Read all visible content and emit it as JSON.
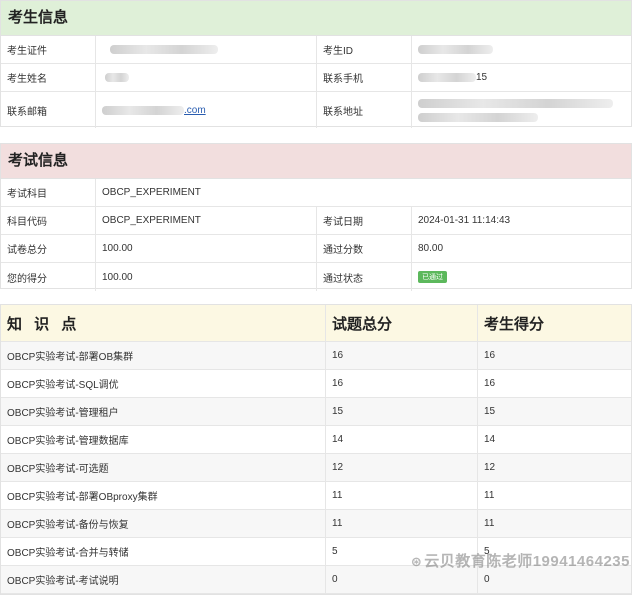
{
  "candidate": {
    "title": "考生信息",
    "rows": [
      {
        "l1": "考生证件",
        "v1": "",
        "l2": "考生ID",
        "v2": ""
      },
      {
        "l1": "考生姓名",
        "v1": "",
        "l2": "联系手机",
        "v2": "15"
      },
      {
        "l1": "联系邮箱",
        "v1": ".com",
        "l2": "联系地址",
        "v2": ""
      }
    ]
  },
  "exam": {
    "title": "考试信息",
    "subject_label": "考试科目",
    "subject_value": "OBCP_EXPERIMENT",
    "code_label": "科目代码",
    "code_value": "OBCP_EXPERIMENT",
    "date_label": "考试日期",
    "date_value": "2024-01-31 11:14:43",
    "total_label": "试卷总分",
    "total_value": "100.00",
    "pass_label": "通过分数",
    "pass_value": "80.00",
    "score_label": "您的得分",
    "score_value": "100.00",
    "status_label": "通过状态",
    "status_value": "已通过",
    "status_color": "#5cb85c"
  },
  "knowledge": {
    "headers": [
      "知 识 点",
      "试题总分",
      "考生得分"
    ],
    "rows": [
      {
        "name": "OBCP实验考试-部署OB集群",
        "total": "16",
        "score": "16"
      },
      {
        "name": "OBCP实验考试-SQL调优",
        "total": "16",
        "score": "16"
      },
      {
        "name": "OBCP实验考试-管理租户",
        "total": "15",
        "score": "15"
      },
      {
        "name": "OBCP实验考试-管理数据库",
        "total": "14",
        "score": "14"
      },
      {
        "name": "OBCP实验考试-可选题",
        "total": "12",
        "score": "12"
      },
      {
        "name": "OBCP实验考试-部署OBproxy集群",
        "total": "11",
        "score": "11"
      },
      {
        "name": "OBCP实验考试-备份与恢复",
        "total": "11",
        "score": "11"
      },
      {
        "name": "OBCP实验考试-合并与转储",
        "total": "5",
        "score": "5"
      },
      {
        "name": "OBCP实验考试-考试说明",
        "total": "0",
        "score": "0"
      }
    ]
  },
  "watermark": "云贝教育陈老师19941464235"
}
